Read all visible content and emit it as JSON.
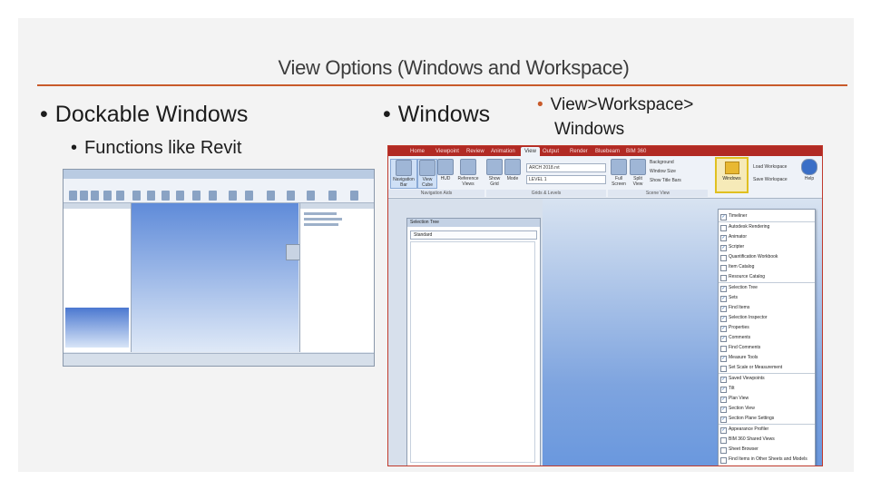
{
  "slide": {
    "title": "View Options (Windows and Workspace)",
    "accent_color": "#c85a2a",
    "bullets": {
      "dockable_windows": "Dockable Windows",
      "functions_like_revit": "Functions like Revit",
      "windows": "Windows",
      "view_workspace": "View>Workspace>",
      "view_workspace_2": "Windows"
    },
    "bullet_char": "•"
  },
  "navisworks": {
    "tabs": [
      "Home",
      "Viewpoint",
      "Review",
      "Animation",
      "View",
      "Output",
      "Render",
      "Bluebeam",
      "BIM 360"
    ],
    "active_tab": "View",
    "ribbon": {
      "navigation_bar": "Navigation Bar",
      "view_cube": "View Cube",
      "hud": "HUD",
      "reference_views": "Reference Views",
      "show_grid": "Show Grid",
      "mode": "Mode",
      "arch_level": "ARCH 2018.rvt",
      "level": "LEVEL 1",
      "full_screen": "Full Screen",
      "split_view": "Split View",
      "background": "Background",
      "window_size": "Window Size",
      "show_title_bars": "Show Title Bars",
      "windows": "Windows",
      "load_workspace": "Load Workspace",
      "save_workspace": "Save Workspace",
      "help": "Help"
    },
    "groups": {
      "navigation_aids": "Navigation Aids",
      "grids_levels": "Grids & Levels",
      "scene_view": "Scene View"
    },
    "panel": {
      "title": "Selection Tree",
      "combo": "Standard"
    },
    "windows_menu": [
      {
        "label": "Timeliner",
        "checked": true
      },
      {
        "label": "Autodesk Rendering",
        "checked": false
      },
      {
        "label": "Animator",
        "checked": true
      },
      {
        "label": "Scripter",
        "checked": true
      },
      {
        "label": "Quantification Workbook",
        "checked": false
      },
      {
        "label": "Item Catalog",
        "checked": false
      },
      {
        "label": "Resource Catalog",
        "checked": false
      },
      {
        "label": "Selection Tree",
        "checked": true
      },
      {
        "label": "Sets",
        "checked": true
      },
      {
        "label": "Find Items",
        "checked": true
      },
      {
        "label": "Selection Inspector",
        "checked": true
      },
      {
        "label": "Properties",
        "checked": true
      },
      {
        "label": "Comments",
        "checked": true
      },
      {
        "label": "Find Comments",
        "checked": false
      },
      {
        "label": "Measure Tools",
        "checked": true
      },
      {
        "label": "Set Scale or Measurement",
        "checked": false
      },
      {
        "label": "Saved Viewpoints",
        "checked": true
      },
      {
        "label": "Tilt",
        "checked": true
      },
      {
        "label": "Plan View",
        "checked": true
      },
      {
        "label": "Section View",
        "checked": true
      },
      {
        "label": "Section Plane Settings",
        "checked": true
      },
      {
        "label": "Appearance Profiler",
        "checked": true
      },
      {
        "label": "BIM 360 Shared Views",
        "checked": false
      },
      {
        "label": "Sheet Browser",
        "checked": false
      },
      {
        "label": "Find Items in Other Sheets and Models",
        "checked": false
      }
    ],
    "check_glyph": "✓"
  }
}
